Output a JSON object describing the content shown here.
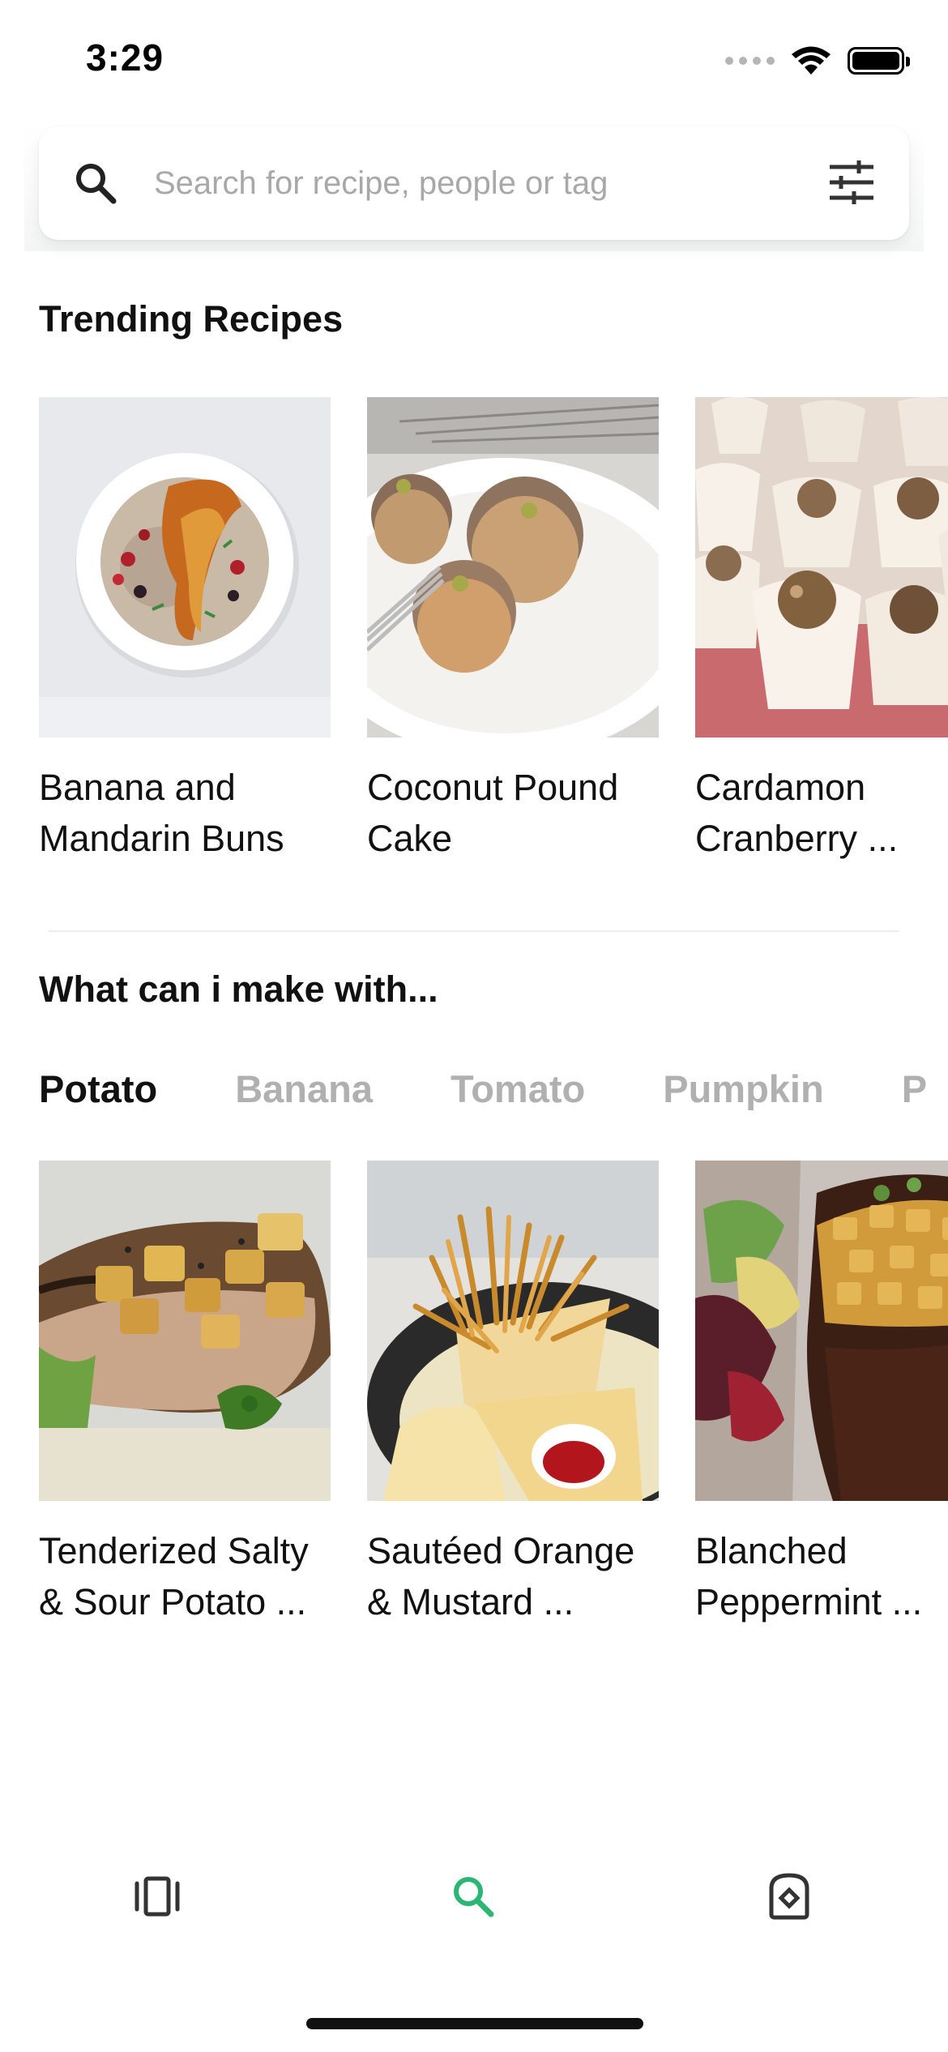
{
  "status": {
    "time": "3:29"
  },
  "search": {
    "placeholder": "Search for recipe, people or tag",
    "value": ""
  },
  "trending": {
    "title": "Trending Recipes",
    "items": [
      {
        "title": "Banana and Mandarin Buns"
      },
      {
        "title": "Coconut Pound Cake"
      },
      {
        "title": "Cardamon Cranberry ..."
      }
    ]
  },
  "make_with": {
    "title": "What can i make with...",
    "tabs": [
      {
        "label": "Potato",
        "active": true
      },
      {
        "label": "Banana",
        "active": false
      },
      {
        "label": "Tomato",
        "active": false
      },
      {
        "label": "Pumpkin",
        "active": false
      }
    ],
    "items": [
      {
        "title": "Tenderized Salty & Sour Potato ..."
      },
      {
        "title": "Sautéed Orange & Mustard ..."
      },
      {
        "title": "Blanched Peppermint ..."
      }
    ]
  },
  "colors": {
    "accent": "#2bb673",
    "text": "#111111",
    "muted": "#b0b0b0"
  },
  "icons": {
    "nav": [
      "carousel-icon",
      "search-icon",
      "cookbook-icon"
    ]
  }
}
